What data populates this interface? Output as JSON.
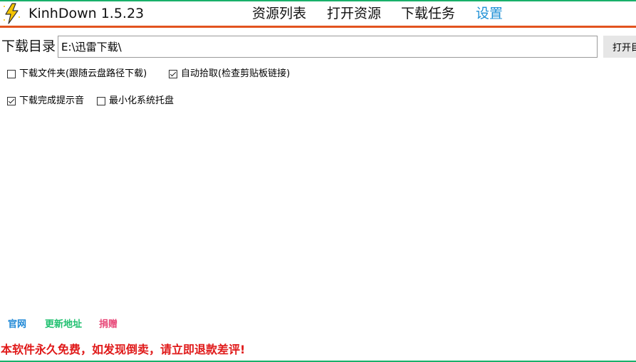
{
  "app": {
    "title": "KinhDown 1.5.23"
  },
  "nav": {
    "tabs": [
      {
        "label": "资源列表",
        "active": false
      },
      {
        "label": "打开资源",
        "active": false
      },
      {
        "label": "下载任务",
        "active": false
      },
      {
        "label": "设置",
        "active": true
      }
    ]
  },
  "settings": {
    "download_dir_label": "下载目录",
    "download_dir_value": "E:\\迅雷下载\\",
    "open_dir_button": "打开目录",
    "checkboxes": [
      {
        "label": "下载文件夹(跟随云盘路径下载)",
        "checked": false
      },
      {
        "label": "自动拾取(检查剪贴板链接)",
        "checked": true
      },
      {
        "label": "下载完成提示音",
        "checked": true
      },
      {
        "label": "最小化系统托盘",
        "checked": false
      }
    ]
  },
  "footer": {
    "links": [
      {
        "label": "官网",
        "color": "#1e88d6"
      },
      {
        "label": "更新地址",
        "color": "#20c070"
      },
      {
        "label": "捐赠",
        "color": "#e84a7a"
      }
    ],
    "notice": "本软件永久免费，如发现倒卖，请立即退款差评!"
  },
  "colors": {
    "accent_active_tab": "#1e90d6",
    "divider": "#e2531e",
    "window_border": "#18b06a",
    "notice": "#e01919"
  },
  "icons": {
    "app_icon": "lightning-bolt-icon"
  }
}
